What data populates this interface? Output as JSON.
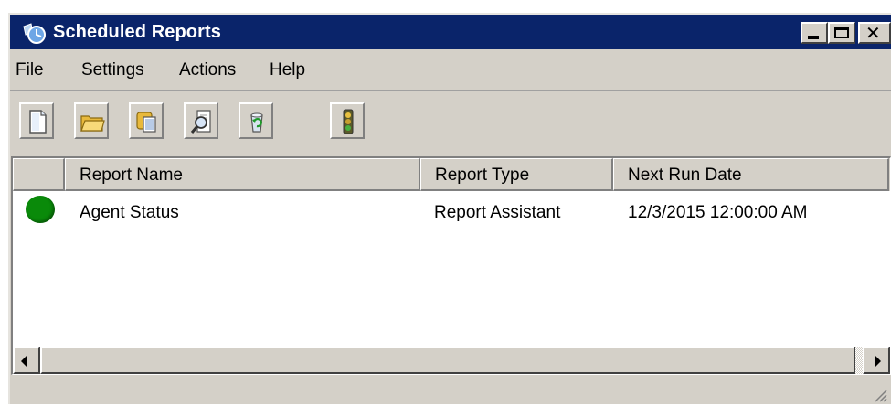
{
  "window": {
    "title": "Scheduled Reports",
    "app_icon": "scheduled-reports-icon",
    "controls": [
      "minimize-icon",
      "maximize-icon",
      "close-icon"
    ],
    "colors": {
      "titlebar": "#0a246a",
      "chrome": "#d4d0c8",
      "status_ok": "#0a8a0a"
    }
  },
  "menu": {
    "file": "File",
    "settings": "Settings",
    "actions": "Actions",
    "help": "Help"
  },
  "toolbar": {
    "buttons": [
      "new-report-icon",
      "open-folder-icon",
      "copy-icon",
      "preview-icon",
      "refresh-icon",
      "traffic-light-icon"
    ]
  },
  "list": {
    "columns": {
      "status": "",
      "name": "Report Name",
      "type": "Report Type",
      "next_run": "Next Run Date"
    },
    "rows": [
      {
        "status_icon": "green-status-icon",
        "name": "Agent Status",
        "type": "Report Assistant",
        "next_run": "12/3/2015 12:00:00 AM"
      }
    ]
  },
  "close_glyph": "✕"
}
